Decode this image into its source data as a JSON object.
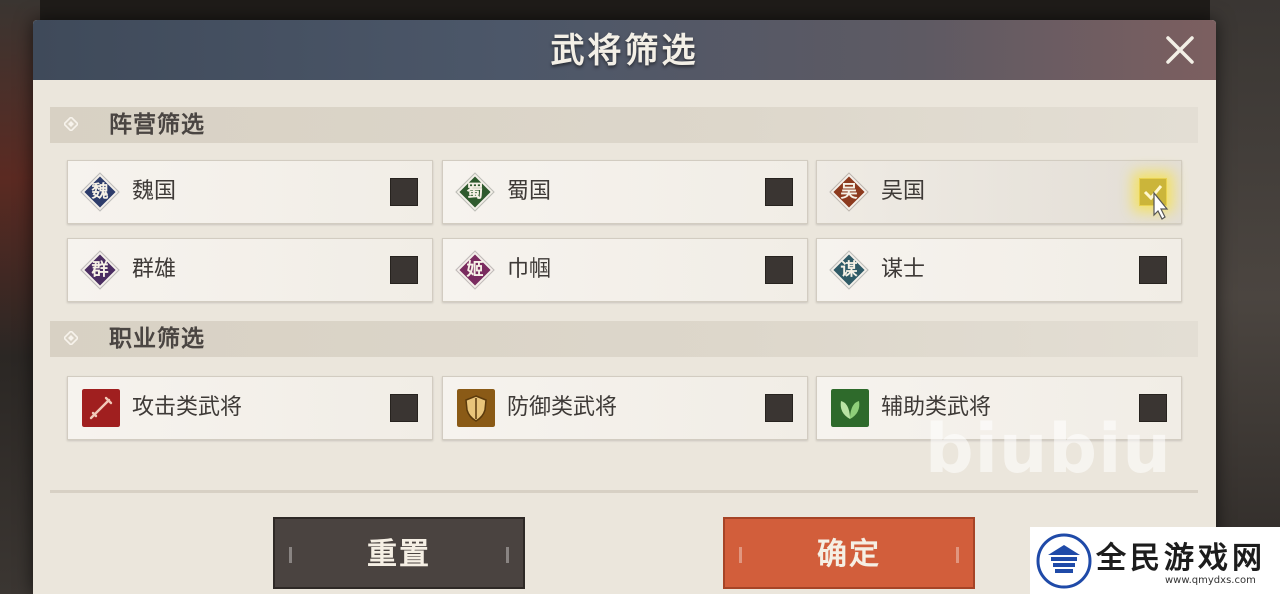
{
  "dialog": {
    "title": "武将筛选"
  },
  "faction_section": {
    "label": "阵营筛选",
    "options": [
      {
        "badge": "魏",
        "label": "魏国",
        "color": "#2d3c6b",
        "checked": false
      },
      {
        "badge": "蜀",
        "label": "蜀国",
        "color": "#2f5a2e",
        "checked": false
      },
      {
        "badge": "吴",
        "label": "吴国",
        "color": "#8c3a1e",
        "checked": true
      },
      {
        "badge": "群",
        "label": "群雄",
        "color": "#4b2d62",
        "checked": false
      },
      {
        "badge": "姬",
        "label": "巾帼",
        "color": "#7a2b5f",
        "checked": false
      },
      {
        "badge": "谋",
        "label": "谋士",
        "color": "#2f5a66",
        "checked": false
      }
    ]
  },
  "role_section": {
    "label": "职业筛选",
    "options": [
      {
        "label": "攻击类武将",
        "icon": "sword-icon",
        "color": "#a01f1f",
        "checked": false
      },
      {
        "label": "防御类武将",
        "icon": "shield-icon",
        "color": "#8a5a16",
        "checked": false
      },
      {
        "label": "辅助类武将",
        "icon": "leaf-icon",
        "color": "#2e6a2b",
        "checked": false
      }
    ]
  },
  "buttons": {
    "reset_label": "重置",
    "confirm_label": "确定"
  },
  "watermark": {
    "text": "biubiu"
  },
  "site_logo": {
    "name": "全民游戏网",
    "url": "www.qmydxs.com"
  },
  "colors": {
    "accent_confirm": "#d25e3b",
    "reset_button": "#4a4340",
    "checked_highlight": "#e8d14f"
  }
}
